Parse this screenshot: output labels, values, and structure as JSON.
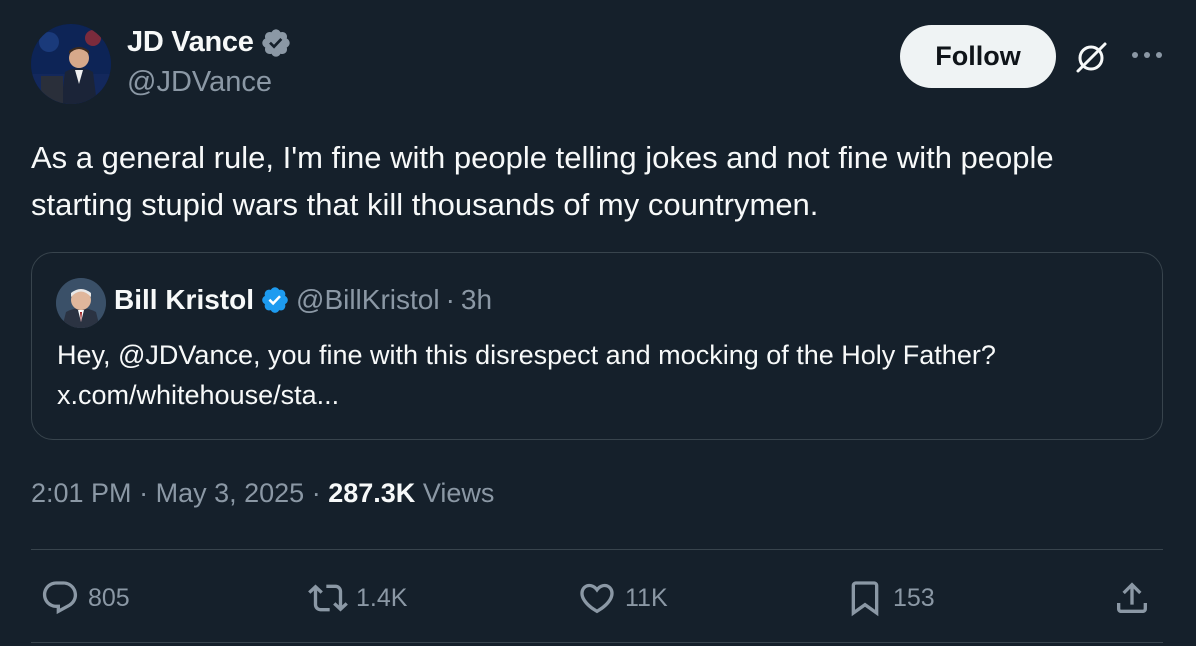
{
  "author": {
    "name": "JD Vance",
    "handle": "@JDVance",
    "verified_icon": "verified-badge-icon"
  },
  "follow_label": "Follow",
  "tweet_text": "As a general rule, I'm fine with people telling jokes and not fine with people starting stupid wars that kill thousands of my countrymen.",
  "quote": {
    "name": "Bill Kristol",
    "handle": "@BillKristol",
    "separator": "·",
    "time": "3h",
    "text": "Hey, @JDVance, you fine with this disrespect and mocking of the Holy Father?",
    "link": "x.com/whitehouse/sta..."
  },
  "meta": {
    "time": "2:01 PM",
    "sep1": "·",
    "date": "May 3, 2025",
    "sep2": "·",
    "views_count": "287.3K",
    "views_label": "Views"
  },
  "actions": {
    "replies": "805",
    "reposts": "1.4K",
    "likes": "11K",
    "bookmarks": "153"
  },
  "colors": {
    "background": "#15202b",
    "text": "#f7f9f9",
    "secondary": "#8b98a5",
    "verified": "#1d9bf0",
    "border": "#38444d"
  }
}
